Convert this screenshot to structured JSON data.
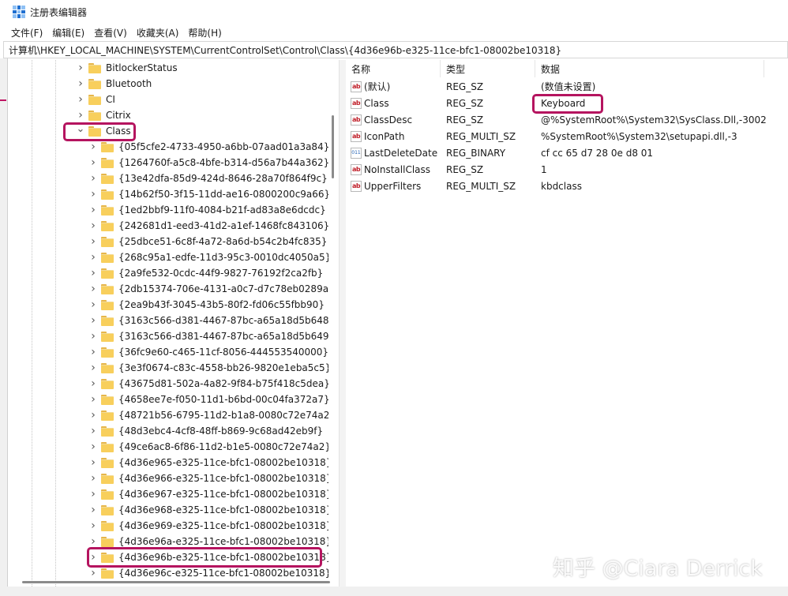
{
  "window": {
    "title": "注册表编辑器"
  },
  "menu": [
    "文件(F)",
    "编辑(E)",
    "查看(V)",
    "收藏夹(A)",
    "帮助(H)"
  ],
  "address": "计算机\\HKEY_LOCAL_MACHINE\\SYSTEM\\CurrentControlSet\\Control\\Class\\{4d36e96b-e325-11ce-bfc1-08002be10318}",
  "tree": {
    "siblings": [
      "BitlockerStatus",
      "Bluetooth",
      "CI",
      "Citrix"
    ],
    "expanded": "Class",
    "children": [
      "{05f5cfe2-4733-4950-a6bb-07aad01a3a84}",
      "{1264760f-a5c8-4bfe-b314-d56a7b44a362}",
      "{13e42dfa-85d9-424d-8646-28a70f864f9c}",
      "{14b62f50-3f15-11dd-ae16-0800200c9a66}",
      "{1ed2bbf9-11f0-4084-b21f-ad83a8e6dcdc}",
      "{242681d1-eed3-41d2-a1ef-1468fc843106}",
      "{25dbce51-6c8f-4a72-8a6d-b54c2b4fc835}",
      "{268c95a1-edfe-11d3-95c3-0010dc4050a5}",
      "{2a9fe532-0cdc-44f9-9827-76192f2ca2fb}",
      "{2db15374-706e-4131-a0c7-d7c78eb0289a}",
      "{2ea9b43f-3045-43b5-80f2-fd06c55fbb90}",
      "{3163c566-d381-4467-87bc-a65a18d5b648}",
      "{3163c566-d381-4467-87bc-a65a18d5b649}",
      "{36fc9e60-c465-11cf-8056-444553540000}",
      "{3e3f0674-c83c-4558-bb26-9820e1eba5c5}",
      "{43675d81-502a-4a82-9f84-b75f418c5dea}",
      "{4658ee7e-f050-11d1-b6bd-00c04fa372a7}",
      "{48721b56-6795-11d2-b1a8-0080c72e74a2}",
      "{48d3ebc4-4cf8-48ff-b869-9c68ad42eb9f}",
      "{49ce6ac8-6f86-11d2-b1e5-0080c72e74a2}",
      "{4d36e965-e325-11ce-bfc1-08002be10318}",
      "{4d36e966-e325-11ce-bfc1-08002be10318}",
      "{4d36e967-e325-11ce-bfc1-08002be10318}",
      "{4d36e968-e325-11ce-bfc1-08002be10318}",
      "{4d36e969-e325-11ce-bfc1-08002be10318}",
      "{4d36e96a-e325-11ce-bfc1-08002be10318}",
      "{4d36e96b-e325-11ce-bfc1-08002be10318}",
      "{4d36e96c-e325-11ce-bfc1-08002be10318}"
    ],
    "selected": "{4d36e96b-e325-11ce-bfc1-08002be10318}"
  },
  "values": {
    "headers": [
      "名称",
      "类型",
      "数据"
    ],
    "rows": [
      {
        "name": "(默认)",
        "type": "REG_SZ",
        "data": "(数值未设置)",
        "icon": "string-value-icon"
      },
      {
        "name": "Class",
        "type": "REG_SZ",
        "data": "Keyboard",
        "icon": "string-value-icon"
      },
      {
        "name": "ClassDesc",
        "type": "REG_SZ",
        "data": "@%SystemRoot%\\System32\\SysClass.Dll,-3002",
        "icon": "string-value-icon"
      },
      {
        "name": "IconPath",
        "type": "REG_MULTI_SZ",
        "data": "%SystemRoot%\\System32\\setupapi.dll,-3",
        "icon": "string-value-icon"
      },
      {
        "name": "LastDeleteDate",
        "type": "REG_BINARY",
        "data": "cf cc 65 d7 28 0e d8 01",
        "icon": "binary-value-icon"
      },
      {
        "name": "NoInstallClass",
        "type": "REG_SZ",
        "data": "1",
        "icon": "string-value-icon"
      },
      {
        "name": "UpperFilters",
        "type": "REG_MULTI_SZ",
        "data": "kbdclass",
        "icon": "string-value-icon"
      }
    ]
  },
  "watermark": "知乎 @Ciara Derrick",
  "colors": {
    "highlight": "#b5145f",
    "folder": "#f8cf5c",
    "accent": "#1f6fd1"
  }
}
